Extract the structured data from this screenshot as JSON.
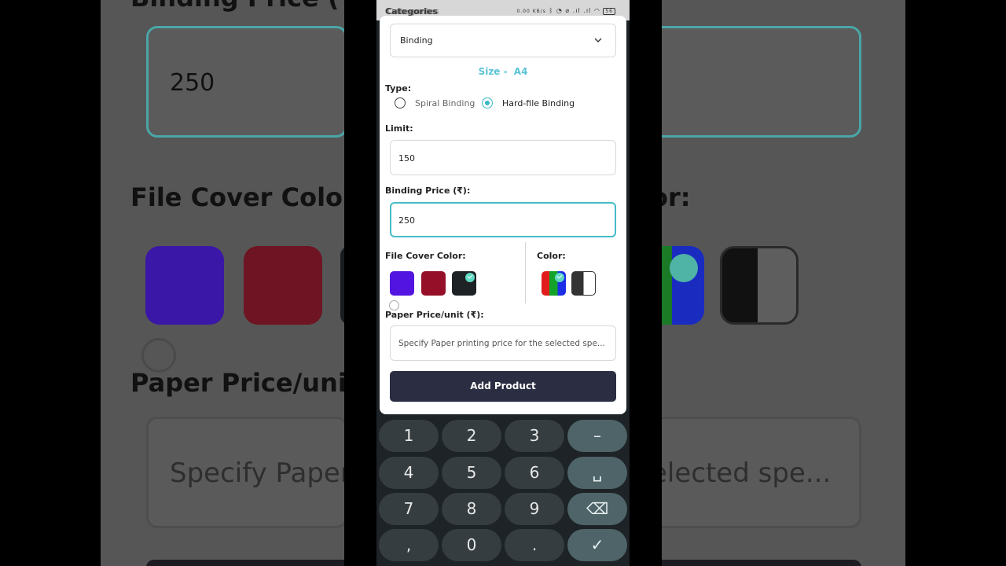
{
  "background": {
    "binding_price_label": "Binding Price (₹",
    "binding_price_value": "250",
    "file_cover_color_label": "File Cover Color",
    "color_label_fragment": "or:",
    "paper_price_label": "Paper Price/unit",
    "paper_price_placeholder_left": "Specify Paper",
    "paper_price_placeholder_right": "elected spe..."
  },
  "statusbar": {
    "title_front": "Categories",
    "title_overlap": "Categories",
    "network_speed": "0.00 KB/s",
    "battery": "56"
  },
  "form": {
    "category_dropdown": {
      "value": "Binding"
    },
    "size": {
      "label": "Size -",
      "value": "A4"
    },
    "type": {
      "label": "Type:",
      "options": [
        "Spiral Binding",
        "Hard-file Binding"
      ],
      "selected": "Hard-file Binding"
    },
    "limit": {
      "label": "Limit:",
      "value": "150"
    },
    "binding_price": {
      "label": "Binding Price (₹):",
      "value": "250"
    },
    "file_cover_color": {
      "label": "File Cover Color:",
      "swatches": [
        "#5214e0",
        "#950f28",
        "#1e2224"
      ],
      "selected_index": 2
    },
    "color": {
      "label": "Color:",
      "options": [
        "rgb-multicolor",
        "black-white"
      ],
      "selected_index": 0
    },
    "paper_price": {
      "label": "Paper Price/unit (₹):",
      "placeholder": "Specify Paper printing price for the selected spe..."
    },
    "submit_label": "Add Product"
  },
  "keyboard": {
    "keys": [
      "1",
      "2",
      "3",
      "–",
      "4",
      "5",
      "6",
      "␣",
      "7",
      "8",
      "9",
      "⌫",
      ",",
      "0",
      ".",
      "✓"
    ]
  },
  "colors": {
    "accent": "#45bcc7",
    "button": "#2b2d42",
    "keyboard_key": "#353d40",
    "keyboard_fn_key": "#4e6468"
  }
}
